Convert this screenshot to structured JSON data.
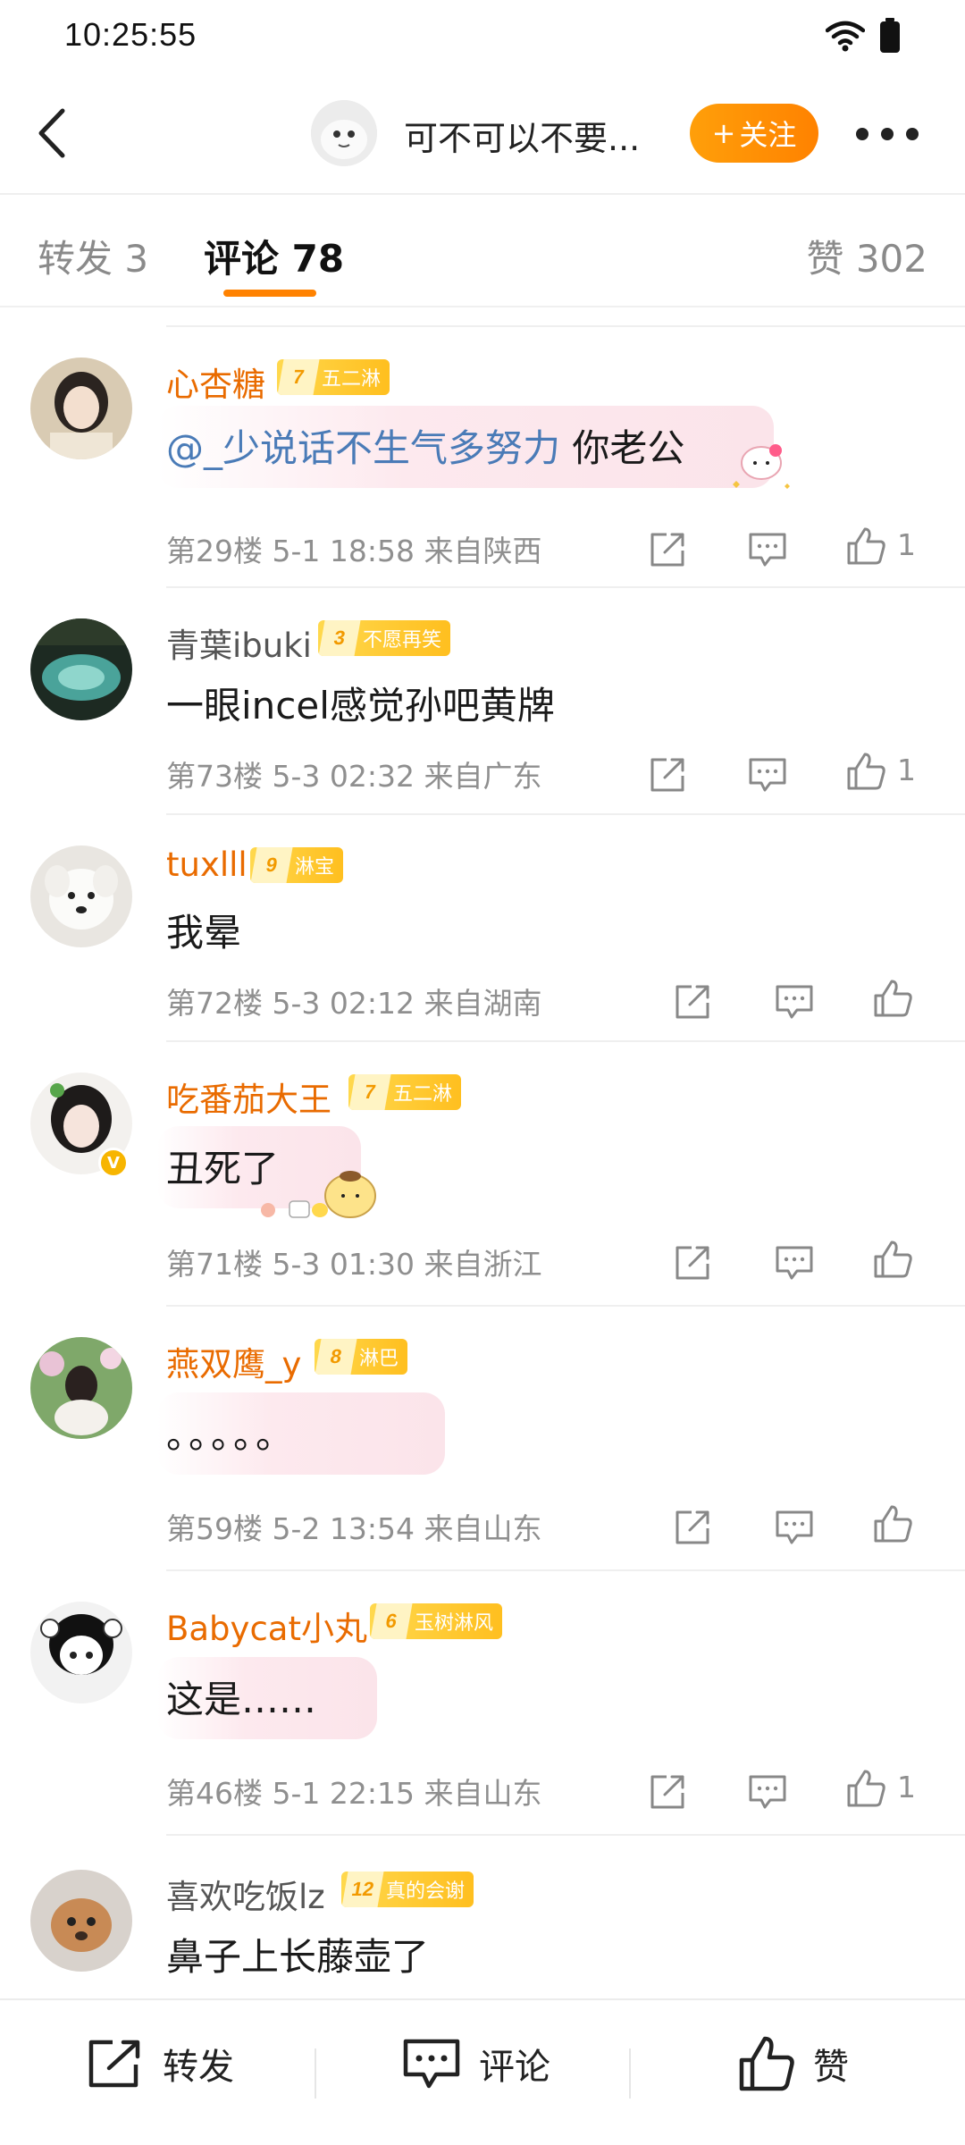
{
  "status_bar": {
    "time": "10:25:55"
  },
  "header": {
    "title": "可不可以不要...",
    "follow_label": "关注"
  },
  "tabs": {
    "repost": "转发 3",
    "comments": "评论 78",
    "likes": "赞 302"
  },
  "comments": [
    {
      "user": "心杏糖",
      "level": "7",
      "fan_name": "五二淋",
      "mention": "@_少说话不生气多努力",
      "text": " 你老公",
      "floor": "第29楼",
      "time": "5-1 18:58",
      "location": "来自陕西",
      "likes": "1"
    },
    {
      "user": "青葉ibuki",
      "level": "3",
      "fan_name": "不愿再笑",
      "text": "一眼incel感觉孙吧黄牌",
      "floor": "第73楼",
      "time": "5-3 02:32",
      "location": "来自广东",
      "likes": "1"
    },
    {
      "user": "tuxlll",
      "level": "9",
      "fan_name": "淋宝",
      "text": "我晕",
      "floor": "第72楼",
      "time": "5-3 02:12",
      "location": "来自湖南",
      "likes": ""
    },
    {
      "user": "吃番茄大王",
      "level": "7",
      "fan_name": "五二淋",
      "text": "丑死了",
      "floor": "第71楼",
      "time": "5-3 01:30",
      "location": "来自浙江",
      "likes": ""
    },
    {
      "user": "燕双鹰_y",
      "level": "8",
      "fan_name": "淋巴",
      "text": "。。。。。",
      "floor": "第59楼",
      "time": "5-2 13:54",
      "location": "来自山东",
      "likes": ""
    },
    {
      "user": "Babycat小丸",
      "level": "6",
      "fan_name": "玉树淋风",
      "text": "这是……",
      "floor": "第46楼",
      "time": "5-1 22:15",
      "location": "来自山东",
      "likes": "1"
    },
    {
      "user": "喜欢吃饭lz",
      "level": "12",
      "fan_name": "真的会谢",
      "text": "鼻子上长藤壶了"
    }
  ],
  "bottom_bar": {
    "repost_label": "转发",
    "comment_label": "评论",
    "like_label": "赞"
  }
}
